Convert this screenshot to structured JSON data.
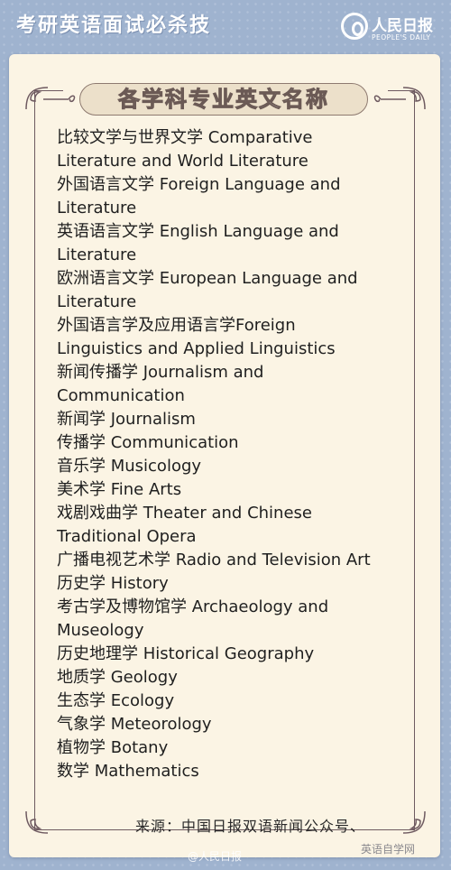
{
  "header": {
    "title": "考研英语面试必杀技",
    "logo_text": "人民日报",
    "logo_sub": "PEOPLE'S DAILY"
  },
  "card": {
    "title": "各学科专业英文名称",
    "lines": [
      "比较文学与世界文学 Comparative",
      "Literature and World Literature",
      "外国语言文学 Foreign Language and",
      "Literature",
      "英语语言文学 English Language and",
      "Literature",
      "欧洲语言文学 European Language and",
      "Literature",
      "外国语言学及应用语言学Foreign",
      "Linguistics and Applied Linguistics",
      "新闻传播学 Journalism and",
      "Communication",
      "新闻学 Journalism",
      "传播学 Communication",
      "音乐学 Musicology",
      "美术学 Fine Arts",
      "戏剧戏曲学 Theater and Chinese",
      "Traditional Opera",
      "广播电视艺术学 Radio and Television Art",
      "历史学 History",
      "考古学及博物馆学 Archaeology and",
      "Museology",
      "历史地理学 Historical Geography",
      "地质学 Geology",
      "生态学  Ecology",
      "气象学 Meteorology",
      "植物学 Botany",
      "数学 Mathematics"
    ],
    "source": "来源：中国日报双语新闻公众号、"
  },
  "watermarks": {
    "weibo": "@人民日报",
    "site": "英语自学网"
  }
}
